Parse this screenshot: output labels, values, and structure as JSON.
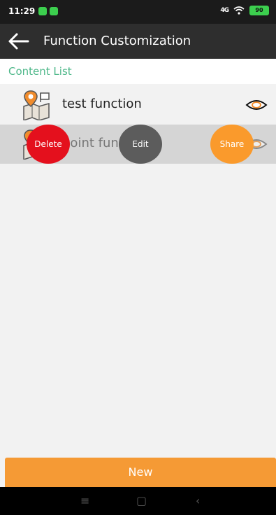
{
  "status_bar": {
    "time": "11:29",
    "signal": "4G",
    "battery": "90"
  },
  "toolbar": {
    "title": "Function Customization"
  },
  "section": {
    "title": "Content List"
  },
  "list": {
    "items": [
      {
        "label": "test function"
      },
      {
        "label": "point fun"
      }
    ]
  },
  "actions": {
    "delete_label": "Delete",
    "edit_label": "Edit",
    "share_label": "Share"
  },
  "footer": {
    "new_label": "New"
  },
  "navbar": {
    "menu": "≡",
    "home": "▢",
    "back": "‹"
  },
  "colors": {
    "accent_orange": "#f59a35",
    "delete_red": "#e4101d",
    "edit_gray": "#5c5c5c",
    "section_green": "#4fb88a"
  }
}
